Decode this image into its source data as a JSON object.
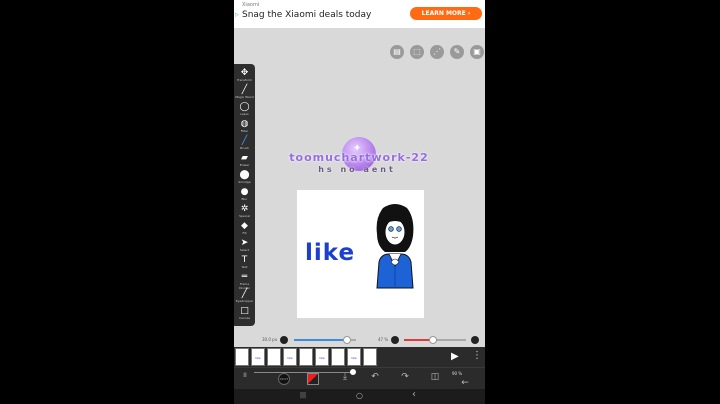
{
  "ad": {
    "brand": "Xiaomi",
    "headline": "Snag the Xiaomi deals today",
    "cta": "LEARN MORE",
    "cta_arrow": "›",
    "adchoice": "▷"
  },
  "top_tools": [
    {
      "icon": "layers-icon",
      "glyph": "▤"
    },
    {
      "icon": "selection-icon",
      "glyph": "⬚"
    },
    {
      "icon": "snap-icon",
      "glyph": "⋰"
    },
    {
      "icon": "pen-icon",
      "glyph": "✎"
    },
    {
      "icon": "image-icon",
      "glyph": "▣"
    }
  ],
  "toolbar": {
    "tools": [
      {
        "label": "Transform",
        "icon": "move-icon",
        "glyph": "✥"
      },
      {
        "label": "Magic Wand",
        "icon": "wand-icon",
        "glyph": "╱"
      },
      {
        "label": "Lasso",
        "icon": "lasso-icon",
        "glyph": "◯"
      },
      {
        "label": "Filter",
        "icon": "filter-icon",
        "glyph": "◍"
      },
      {
        "label": "Brush",
        "icon": "brush-icon",
        "glyph": "╱"
      },
      {
        "label": "Eraser",
        "icon": "eraser-icon",
        "glyph": "▰"
      },
      {
        "label": "Smudge",
        "icon": "smudge-icon",
        "glyph": "⬤"
      },
      {
        "label": "Blur",
        "icon": "blur-icon",
        "glyph": "●"
      },
      {
        "label": "Special",
        "icon": "special-icon",
        "glyph": "✲"
      },
      {
        "label": "Fill",
        "icon": "fill-icon",
        "glyph": "◆"
      },
      {
        "label": "Select",
        "icon": "cursor-icon",
        "glyph": "➤"
      },
      {
        "label": "Text",
        "icon": "text-icon",
        "glyph": "T"
      },
      {
        "label": "Frame Divider",
        "icon": "divider-icon",
        "glyph": "═"
      },
      {
        "label": "Eyedropper",
        "icon": "eyedropper-icon",
        "glyph": "╱"
      },
      {
        "label": "Canvas",
        "icon": "canvas-icon",
        "glyph": "□"
      }
    ]
  },
  "canvas": {
    "text": "like"
  },
  "watermark": {
    "handle": "toomuchartwork-22",
    "label": "hs no aent",
    "star": "✦"
  },
  "sliders": {
    "size_label": "30.0 px",
    "size_value": 0.85,
    "opacity_label": "47 %",
    "opacity_value": 0.47,
    "size_color": "#3a8fd8",
    "opacity_color": "#e23a3a"
  },
  "layers": {
    "thumbs": [
      "",
      "like",
      "",
      "like",
      "",
      "like",
      "",
      "like",
      ""
    ],
    "play": "▶",
    "more": "⋮"
  },
  "bottombar": {
    "pause": "II",
    "frame_label": "00:07",
    "page": "90 %",
    "undo": "↶",
    "redo": "↷",
    "down": "⤓",
    "back": "←",
    "layers": "◫"
  },
  "navbar": {
    "recent": "|||",
    "home": "○",
    "back": "‹"
  }
}
